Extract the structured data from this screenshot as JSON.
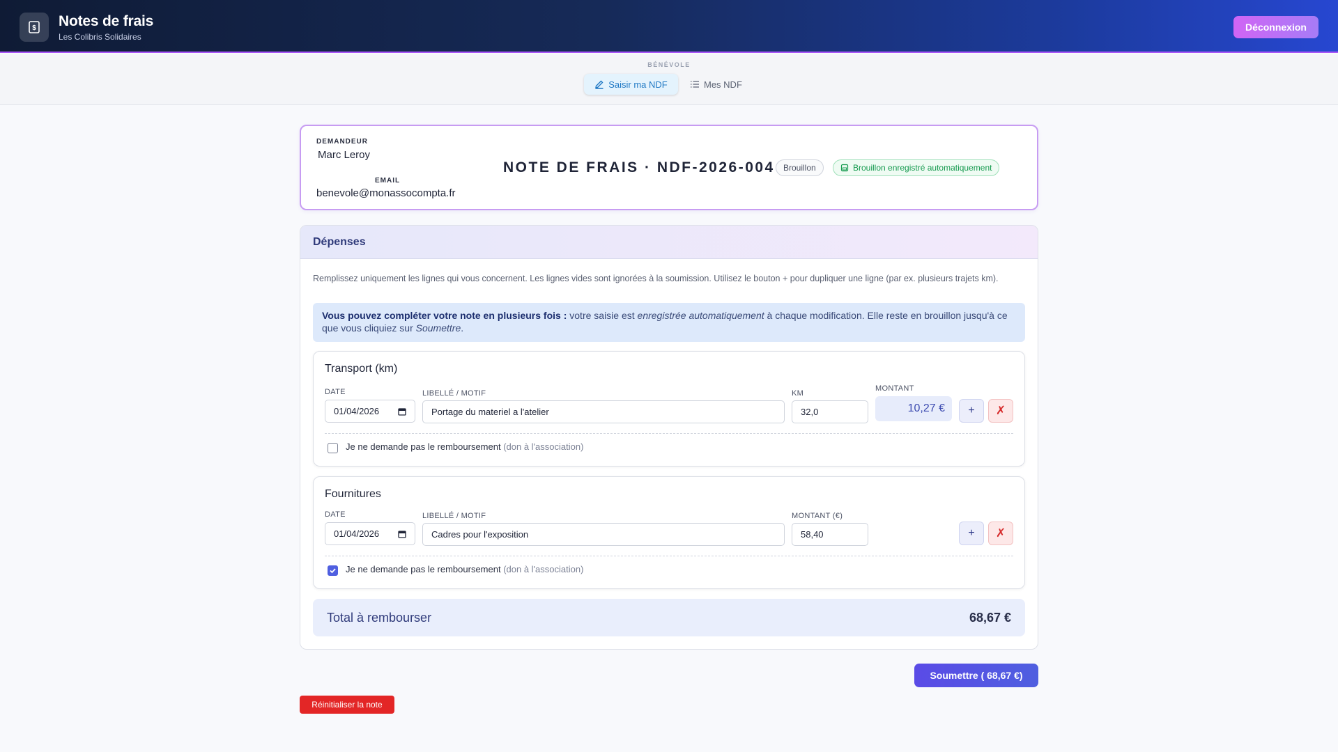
{
  "app": {
    "title": "Notes de frais",
    "subtitle": "Les Colibris Solidaires",
    "logout_label": "Déconnexion"
  },
  "nav": {
    "section_label": "BÉNÉVOLE",
    "tabs": [
      {
        "label": "Saisir ma NDF",
        "active": true
      },
      {
        "label": "Mes NDF",
        "active": false
      }
    ]
  },
  "header_card": {
    "requester_label": "DEMANDEUR",
    "requester_name": "Marc Leroy",
    "email_label": "EMAIL",
    "email": "benevole@monassocompta.fr",
    "title": "NOTE DE FRAIS · NDF-2026-004",
    "status_badge": "Brouillon",
    "autosave_badge": "Brouillon enregistré automatiquement"
  },
  "expenses": {
    "title": "Dépenses",
    "help": "Remplissez uniquement les lignes qui vous concernent. Les lignes vides sont ignorées à la soumission. Utilisez le bouton + pour dupliquer une ligne (par ex. plusieurs trajets km).",
    "info_bold": "Vous pouvez compléter votre note en plusieurs fois :",
    "info_text1": " votre saisie est ",
    "info_em1": "enregistrée automatiquement",
    "info_text2": " à chaque modification. Elle reste en brouillon jusqu'à ce que vous cliquiez sur ",
    "info_em2": "Soumettre",
    "info_text3": ".",
    "transport": {
      "title": "Transport (km)",
      "date_label": "DATE",
      "date_value": "01/04/2026",
      "motif_label": "LIBELLÉ / MOTIF",
      "motif_value": "Portage du materiel a l'atelier",
      "km_label": "KM",
      "km_value": "32,0",
      "amount_label": "MONTANT",
      "amount_value": "10,27 €",
      "plus_label": "+",
      "delete_label": "✗",
      "no_refund_label": "Je ne demande pas le remboursement",
      "no_refund_note": " (don à l'association)",
      "no_refund_checked": false
    },
    "supplies": {
      "title": "Fournitures",
      "date_label": "DATE",
      "date_value": "01/04/2026",
      "motif_label": "LIBELLÉ / MOTIF",
      "motif_value": "Cadres pour l'exposition",
      "amount_label": "MONTANT (€)",
      "amount_value": "58,40",
      "plus_label": "+",
      "delete_label": "✗",
      "no_refund_label": "Je ne demande pas le remboursement",
      "no_refund_note": " (don à l'association)",
      "no_refund_checked": true
    },
    "total_label": "Total à rembourser",
    "total_value": "68,67 €"
  },
  "actions": {
    "submit_label": "Soumettre ( 68,67 €)",
    "reset_label": "Réinitialiser la note"
  },
  "colors": {
    "accent": "#4f5fe0",
    "danger": "#e32626",
    "success": "#169a4f",
    "header_dark": "#0f1b35"
  }
}
